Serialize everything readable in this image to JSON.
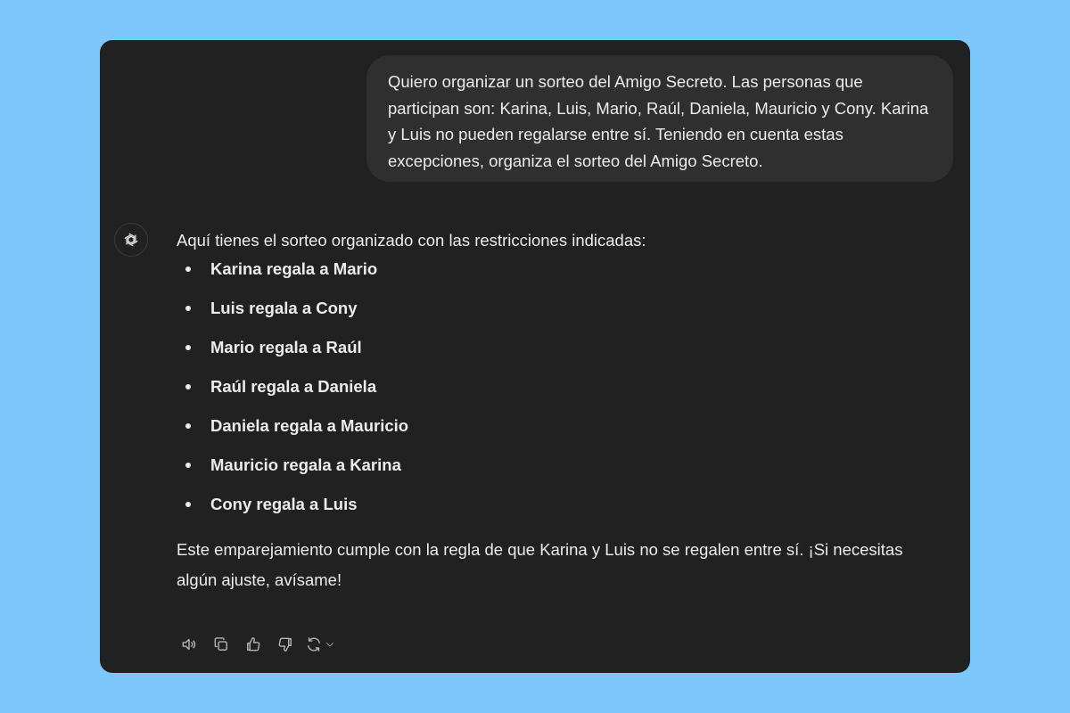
{
  "user_message": {
    "text": "Quiero organizar un sorteo del Amigo Secreto. Las personas que participan son: Karina, Luis, Mario, Raúl, Daniela, Mauricio y Cony. Karina y Luis no pueden regalarse entre sí. Teniendo en cuenta estas excepciones, organiza el sorteo del Amigo Secreto."
  },
  "assistant": {
    "avatar_icon": "openai-logo-icon",
    "intro": "Aquí tienes el sorteo organizado con las restricciones indicadas:",
    "pairs": [
      "Karina regala a Mario",
      "Luis regala a Cony",
      "Mario regala a Raúl",
      "Raúl regala a Daniela",
      "Daniela regala a Mauricio",
      "Mauricio regala a Karina",
      "Cony regala a Luis"
    ],
    "outro": "Este emparejamiento cumple con la regla de que Karina y Luis no se regalen entre sí. ¡Si necesitas algún ajuste, avísame!"
  },
  "actions": {
    "icons": [
      "speaker-icon",
      "copy-icon",
      "thumbs-up-icon",
      "thumbs-down-icon",
      "regenerate-icon",
      "chevron-down-icon"
    ]
  },
  "colors": {
    "background": "#7cc8fc",
    "window": "#212121",
    "user_bubble": "#2f2f2f",
    "text": "#ececec",
    "icon": "#b4b4b4"
  }
}
